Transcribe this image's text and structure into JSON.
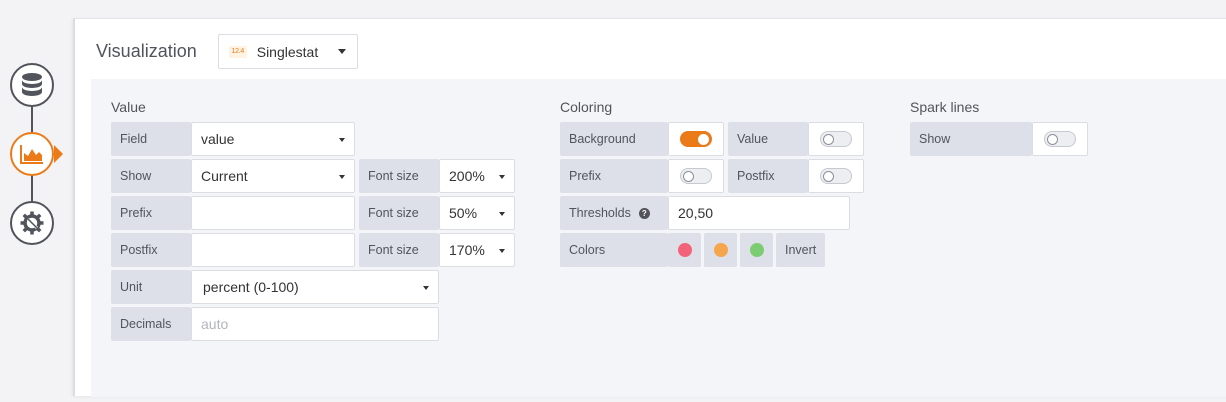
{
  "rail": {
    "items": [
      {
        "icon": "database-icon",
        "active": false
      },
      {
        "icon": "area-chart-icon",
        "active": true
      },
      {
        "icon": "gear-wrench-icon",
        "active": false
      }
    ]
  },
  "header": {
    "title": "Visualization",
    "picker_thumb": "12.4",
    "picker_value": "Singlestat"
  },
  "value_section": {
    "title": "Value",
    "field_label": "Field",
    "field_value": "value",
    "show_label": "Show",
    "show_value": "Current",
    "prefix_label": "Prefix",
    "prefix_value": "",
    "postfix_label": "Postfix",
    "postfix_value": "",
    "fontsize_label": "Font size",
    "show_fontsize": "200%",
    "prefix_fontsize": "50%",
    "postfix_fontsize": "170%",
    "unit_label": "Unit",
    "unit_value": "percent (0-100)",
    "decimals_label": "Decimals",
    "decimals_placeholder": "auto"
  },
  "coloring_section": {
    "title": "Coloring",
    "background_label": "Background",
    "background_on": true,
    "value_label": "Value",
    "value_on": false,
    "prefix_label": "Prefix",
    "prefix_on": false,
    "postfix_label": "Postfix",
    "postfix_on": false,
    "thresholds_label": "Thresholds",
    "thresholds_value": "20,50",
    "colors_label": "Colors",
    "colors": [
      "#f2637a",
      "#f5a54c",
      "#7ccc72"
    ],
    "invert_label": "Invert"
  },
  "sparkline_section": {
    "title": "Spark lines",
    "show_label": "Show",
    "show_on": false
  }
}
